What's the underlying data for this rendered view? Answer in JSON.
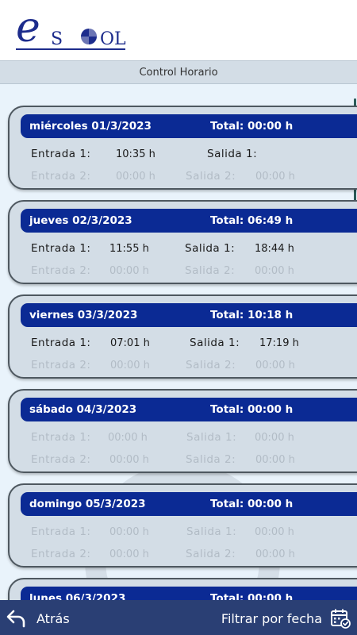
{
  "app": {
    "logo_e": "e",
    "logo_s": "S",
    "logo_ol": "OL",
    "section_title": "Control Horario"
  },
  "days": [
    {
      "date": "miércoles 01/3/2023",
      "total": "Total: 00:00 h",
      "row1": {
        "in_label": "Entrada 1:",
        "in_value": "10:35 h",
        "out_label": "Salida 1:",
        "out_value": ""
      },
      "row2": {
        "in_label": "Entrada 2:",
        "in_value": "00:00 h",
        "out_label": "Salida 2:",
        "out_value": "00:00 h"
      }
    },
    {
      "date": "jueves 02/3/2023",
      "total": "Total: 06:49 h",
      "row1": {
        "in_label": "Entrada 1:",
        "in_value": "11:55 h",
        "out_label": "Salida 1:",
        "out_value": "18:44 h"
      },
      "row2": {
        "in_label": "Entrada 2:",
        "in_value": "00:00 h",
        "out_label": "Salida 2:",
        "out_value": "00:00 h"
      }
    },
    {
      "date": "viernes 03/3/2023",
      "total": "Total: 10:18 h",
      "row1": {
        "in_label": "Entrada 1:",
        "in_value": "07:01 h",
        "out_label": "Salida 1:",
        "out_value": "17:19 h"
      },
      "row2": {
        "in_label": "Entrada 2:",
        "in_value": "00:00 h",
        "out_label": "Salida 2:",
        "out_value": "00:00 h"
      }
    },
    {
      "date": "sábado 04/3/2023",
      "total": "Total: 00:00 h",
      "row1": {
        "in_label": "Entrada 1:",
        "in_value": "00:00 h",
        "out_label": "Salida 1:",
        "out_value": "00:00 h"
      },
      "row2": {
        "in_label": "Entrada 2:",
        "in_value": "00:00 h",
        "out_label": "Salida 2:",
        "out_value": "00:00 h"
      }
    },
    {
      "date": "domingo 05/3/2023",
      "total": "Total: 00:00 h",
      "row1": {
        "in_label": "Entrada 1:",
        "in_value": "00:00 h",
        "out_label": "Salida 1:",
        "out_value": "00:00 h"
      },
      "row2": {
        "in_label": "Entrada 2:",
        "in_value": "00:00 h",
        "out_label": "Salida 2:",
        "out_value": "00:00 h"
      }
    },
    {
      "date": "lunes 06/3/2023",
      "total": "Total: 00:00 h",
      "row1": {
        "in_label": "",
        "in_value": "",
        "out_label": "",
        "out_value": ""
      },
      "row2": {
        "in_label": "",
        "in_value": "",
        "out_label": "",
        "out_value": ""
      }
    }
  ],
  "footer": {
    "back_label": "Atrás",
    "filter_label": "Filtrar por fecha",
    "back_icon": "back-arrow-icon",
    "filter_icon": "calendar-check-icon"
  },
  "colors": {
    "brand_blue": "#0b2a94",
    "card_bg": "#d3dde6",
    "footer_bg": "#182f68",
    "muted_text": "#b2bcc6"
  }
}
